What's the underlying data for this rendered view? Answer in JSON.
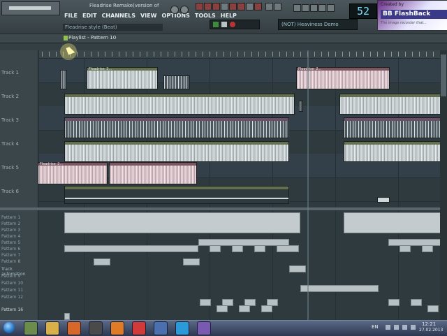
{
  "toolbar": {
    "menu": [
      "FILE",
      "EDIT",
      "CHANNELS",
      "VIEW",
      "OPTIONS",
      "TOOLS",
      "HELP"
    ],
    "title": "Fleadrise Remake(version of th",
    "hint": "Fleadrise style (Beat)",
    "tempo": "52",
    "plugin_box": "(NOT) Heaviness Demo"
  },
  "banner": {
    "top": "Created by",
    "main": "BB FlashBack",
    "sub": "The image recorder that..."
  },
  "playlist": {
    "title": "Playlist - Pattern 10",
    "tracks": [
      "Track 1",
      "Track 2",
      "Track 3",
      "Track 4",
      "Track 5",
      "Track 6"
    ],
    "clip_label": "Fleadrise_2...",
    "pattern_labels": [
      "Pattern 1",
      "Pattern 2",
      "Pattern 3",
      "Pattern 4",
      "Pattern 5",
      "Pattern 6",
      "Pattern 7",
      "Pattern 8"
    ],
    "automation_label": "Track automation",
    "auto_rows": [
      "Pattern 9",
      "Pattern 10",
      "Pattern 11",
      "Pattern 12"
    ],
    "last_label": "Pattern 16"
  },
  "taskbar": {
    "lang": "EN",
    "time": "12:21",
    "date": "27.02.2013",
    "icons": [
      {
        "name": "windows-explorer-icon",
        "color": "#6b8c4a"
      },
      {
        "name": "folder-icon",
        "color": "#d8b04a"
      },
      {
        "name": "firefox-icon",
        "color": "#d8682a"
      },
      {
        "name": "media-icon",
        "color": "#4a4a4a"
      },
      {
        "name": "fl-studio-icon",
        "color": "#e07a24"
      },
      {
        "name": "yandex-icon",
        "color": "#d23a3a"
      },
      {
        "name": "audio-icon",
        "color": "#4a70b0"
      },
      {
        "name": "skype-icon",
        "color": "#2a9ad8"
      },
      {
        "name": "media-player-icon",
        "color": "#7a5ab0"
      }
    ]
  }
}
